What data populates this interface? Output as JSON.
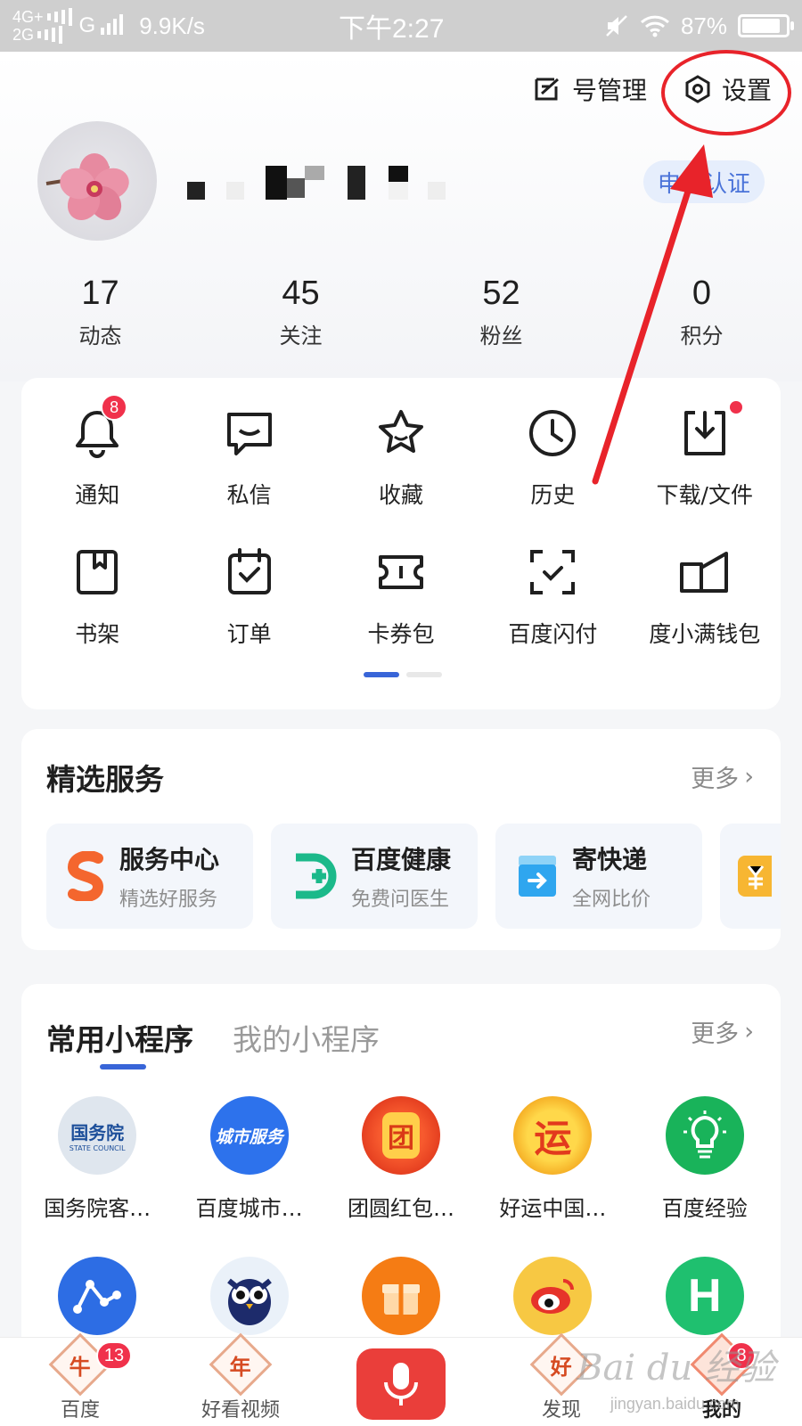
{
  "status_bar": {
    "network_top": "4G+",
    "network_bottom": "2G",
    "signal_g": "G",
    "speed": "9.9K/s",
    "time": "下午2:27",
    "battery_text": "87%",
    "battery_level": 0.87
  },
  "header": {
    "account_manage_label": "号管理",
    "settings_label": "设置",
    "certify_label": "申请认证"
  },
  "stats": [
    {
      "value": "17",
      "label": "动态"
    },
    {
      "value": "45",
      "label": "关注"
    },
    {
      "value": "52",
      "label": "粉丝"
    },
    {
      "value": "0",
      "label": "积分"
    }
  ],
  "quick_grid": [
    {
      "label": "通知",
      "icon": "bell-icon",
      "badge": "8"
    },
    {
      "label": "私信",
      "icon": "message-icon"
    },
    {
      "label": "收藏",
      "icon": "star-icon"
    },
    {
      "label": "历史",
      "icon": "clock-icon"
    },
    {
      "label": "下载/文件",
      "icon": "download-icon"
    },
    {
      "label": "书架",
      "icon": "bookshelf-icon"
    },
    {
      "label": "订单",
      "icon": "order-icon"
    },
    {
      "label": "卡券包",
      "icon": "coupon-icon"
    },
    {
      "label": "百度闪付",
      "icon": "scan-pay-icon"
    },
    {
      "label": "度小满钱包",
      "icon": "wallet-icon"
    }
  ],
  "services": {
    "title": "精选服务",
    "more": "更多",
    "items": [
      {
        "title": "服务中心",
        "subtitle": "精选好服务",
        "icon": "service-center-icon"
      },
      {
        "title": "百度健康",
        "subtitle": "免费问医生",
        "icon": "health-icon"
      },
      {
        "title": "寄快递",
        "subtitle": "全网比价",
        "icon": "express-icon"
      }
    ]
  },
  "mini_programs": {
    "tab_common": "常用小程序",
    "tab_mine": "我的小程序",
    "more": "更多",
    "apps": [
      {
        "label": "国务院客…",
        "icon": "state-council-icon",
        "glyph": "国务院"
      },
      {
        "label": "百度城市…",
        "icon": "city-service-icon",
        "glyph": "城市服务"
      },
      {
        "label": "团圆红包…",
        "icon": "reunion-redpacket-icon",
        "glyph": "团"
      },
      {
        "label": "好运中国…",
        "icon": "good-luck-icon",
        "glyph": "运"
      },
      {
        "label": "百度经验",
        "icon": "experience-bulb-icon",
        "glyph": ""
      },
      {
        "label": "",
        "icon": "graph-icon",
        "glyph": ""
      },
      {
        "label": "",
        "icon": "owl-icon",
        "glyph": ""
      },
      {
        "label": "",
        "icon": "gift-icon",
        "glyph": ""
      },
      {
        "label": "",
        "icon": "weibo-icon",
        "glyph": ""
      },
      {
        "label": "",
        "icon": "h-icon",
        "glyph": "H"
      }
    ]
  },
  "bottom_nav": {
    "items": [
      {
        "label": "百度",
        "glyph": "牛",
        "badge": "13"
      },
      {
        "label": "好看视频",
        "glyph": "年"
      },
      {
        "label": "",
        "glyph": ""
      },
      {
        "label": "发现",
        "glyph": "好"
      },
      {
        "label": "我的",
        "glyph": "",
        "badge": "8"
      }
    ]
  },
  "watermark": {
    "main": "Bai du 经验",
    "sub": "jingyan.baidu.com"
  },
  "colors": {
    "accent_blue": "#3865d8",
    "badge_red": "#f0314b",
    "annotation_red": "#e8232a",
    "mic_red": "#ea3e3a"
  }
}
